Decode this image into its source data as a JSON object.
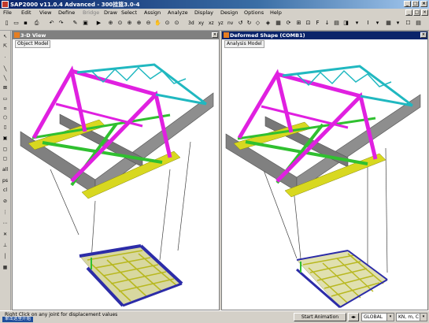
{
  "title": "SAP2000 v11.0.4 Advanced - 300挂篮3.0-4",
  "menu": [
    "File",
    "Edit",
    "View",
    "Define",
    "Bridge",
    "Draw",
    "Select",
    "Assign",
    "Analyze",
    "Display",
    "Design",
    "Options",
    "Help"
  ],
  "menu_disabled": "Bridge",
  "toolbar": {
    "view_3d": "3d",
    "view_xy": "xy",
    "view_xz": "xz",
    "view_yz": "yz",
    "view_nv": "nv"
  },
  "left_pane": {
    "title": "3-D View",
    "tab": "Object Model"
  },
  "right_pane": {
    "title": "Deformed Shape (COMB1)",
    "tab": "Analysis Model"
  },
  "status": {
    "message": "Right Click on any joint for displacement values",
    "start_label": "单击这里开始",
    "animation_button": "Start Animation",
    "coord_system": "GLOBAL",
    "units": "KN, m, C"
  },
  "colors": {
    "magenta": "#e020e0",
    "cyan": "#20b8c0",
    "green": "#30c030",
    "yellow": "#d8d820",
    "gray": "#808080",
    "blue": "#4040c0"
  }
}
